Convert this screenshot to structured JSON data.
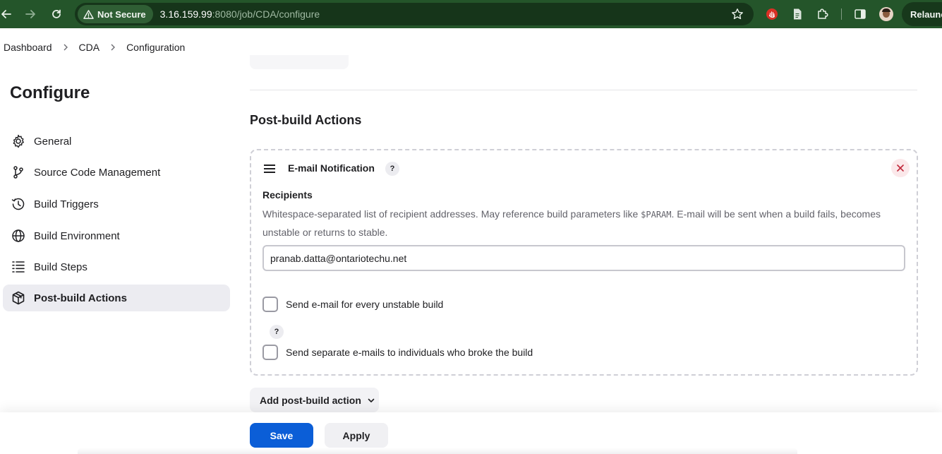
{
  "browser": {
    "security_label": "Not Secure",
    "url_host": "3.16.159.99",
    "url_rest": ":8080/job/CDA/configure",
    "relaunch_label": "Relaunch",
    "icons": [
      "back-icon",
      "forward-icon",
      "reload-icon",
      "warning-icon",
      "star-icon",
      "extension-red-icon",
      "document-icon",
      "puzzle-icon",
      "side-panel-icon",
      "avatar"
    ]
  },
  "breadcrumb": [
    "Dashboard",
    "CDA",
    "Configuration"
  ],
  "sidebar": {
    "title": "Configure",
    "items": [
      {
        "label": "General",
        "icon": "gear-icon"
      },
      {
        "label": "Source Code Management",
        "icon": "branch-icon"
      },
      {
        "label": "Build Triggers",
        "icon": "clock-icon"
      },
      {
        "label": "Build Environment",
        "icon": "globe-icon"
      },
      {
        "label": "Build Steps",
        "icon": "list-icon"
      },
      {
        "label": "Post-build Actions",
        "icon": "package-icon",
        "active": true
      }
    ]
  },
  "main": {
    "section_title": "Post-build Actions",
    "email_card": {
      "title": "E-mail Notification",
      "help": "?",
      "recipients_label": "Recipients",
      "description_part1": "Whitespace-separated list of recipient addresses. May reference build parameters like ",
      "description_code": "$PARAM",
      "description_part2": ". E-mail will be sent when a build fails, becomes unstable or returns to stable.",
      "recipients_value": "pranab.datta@ontariotechu.net",
      "checkbox_unstable_label": "Send e-mail for every unstable build",
      "checkbox_unstable_checked": false,
      "checkbox_individuals_label": "Send separate e-mails to individuals who broke the build",
      "checkbox_individuals_checked": false
    },
    "add_action_label": "Add post-build action"
  },
  "footer": {
    "save_label": "Save",
    "apply_label": "Apply"
  },
  "colors": {
    "chrome_bg": "#24552a",
    "primary": "#0b5ed7",
    "danger": "#c1283a",
    "active_nav_bg": "#ececf1"
  }
}
